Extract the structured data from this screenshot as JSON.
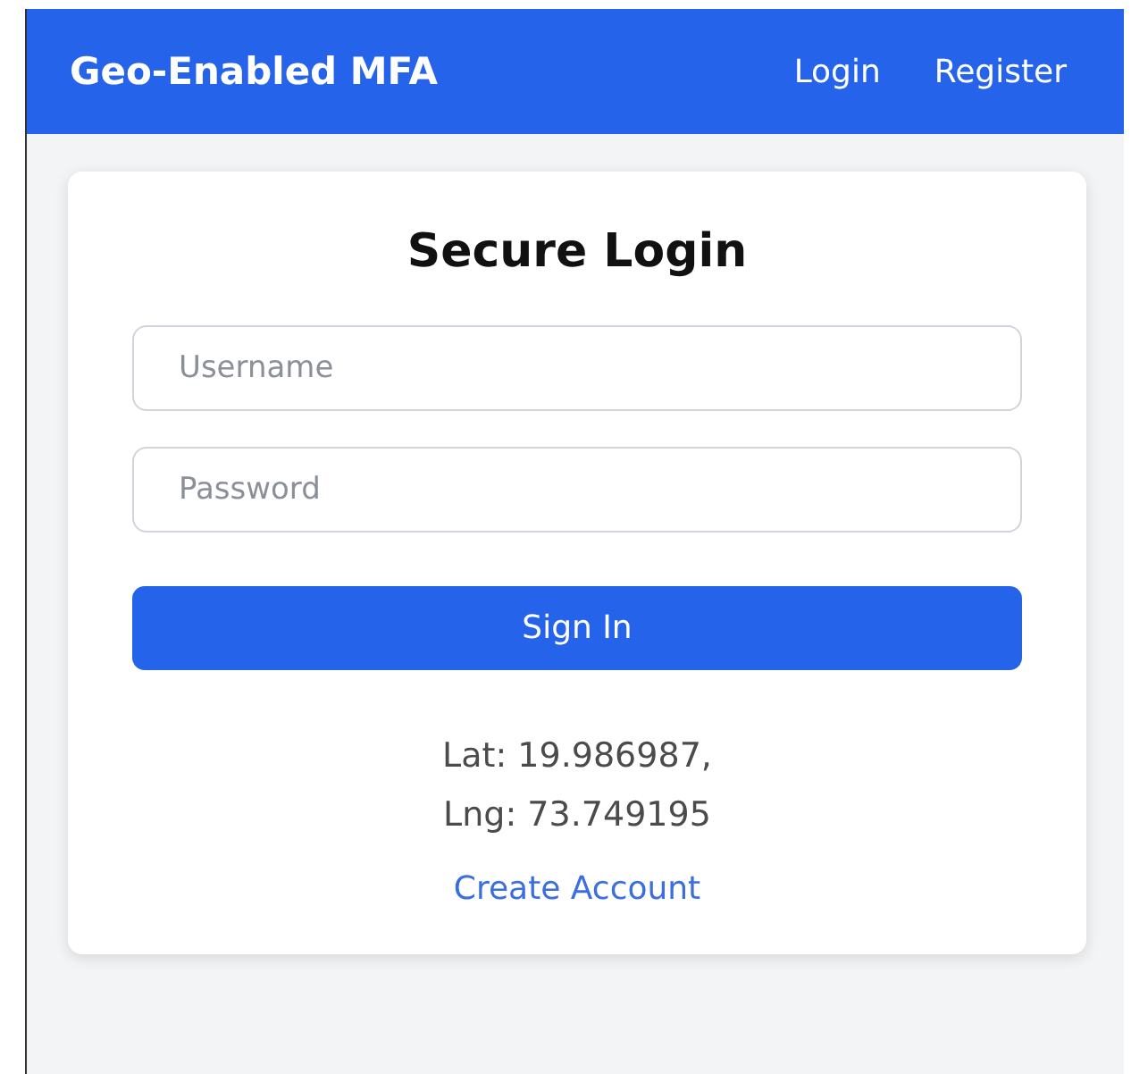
{
  "header": {
    "brand": "Geo-Enabled MFA",
    "nav": [
      {
        "label": "Login"
      },
      {
        "label": "Register"
      }
    ]
  },
  "login": {
    "title": "Secure Login",
    "fields": [
      {
        "placeholder": "Username"
      },
      {
        "placeholder": "Password"
      }
    ],
    "button": "Sign In",
    "location": [
      "Lat: 19.986987,",
      "Lng: 73.749195"
    ],
    "link": "Create Account"
  }
}
